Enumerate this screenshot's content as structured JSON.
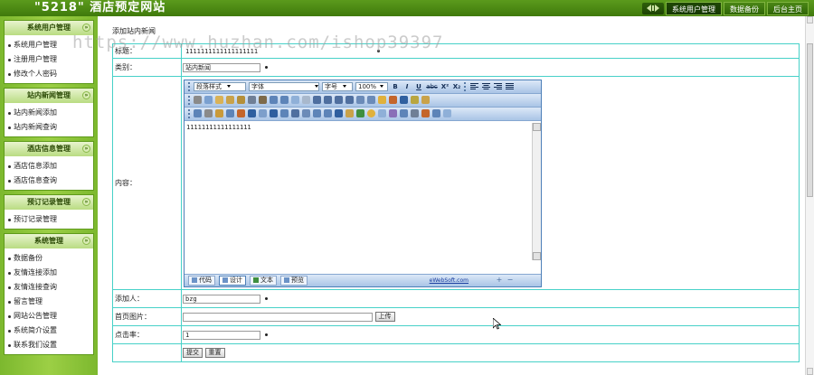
{
  "header": {
    "site_title": "\"5218\" 酒店预定网站",
    "nav": [
      {
        "label": "系统用户管理"
      },
      {
        "label": "数据备份"
      },
      {
        "label": "后台主页"
      }
    ]
  },
  "sidebar": {
    "groups": [
      {
        "title": "系统用户管理",
        "items": [
          "系统用户管理",
          "注册用户管理",
          "修改个人密码"
        ]
      },
      {
        "title": "站内新闻管理",
        "items": [
          "站内新闻添加",
          "站内新闻查询"
        ]
      },
      {
        "title": "酒店信息管理",
        "items": [
          "酒店信息添加",
          "酒店信息查询"
        ]
      },
      {
        "title": "预订记录管理",
        "items": [
          "预订记录管理"
        ]
      },
      {
        "title": "系统管理",
        "items": [
          "数据备份",
          "友情连接添加",
          "友情连接查询",
          "留言管理",
          "网站公告管理",
          "系统简介设置",
          "联系我们设置"
        ]
      }
    ]
  },
  "main": {
    "heading": "添加站内新闻",
    "form": {
      "title_label": "标题：",
      "title_value": "1111111111111111111",
      "category_label": "类别：",
      "category_value": "站内新闻",
      "content_label": "内容：",
      "editor": {
        "format_select": "段落样式",
        "font_select": "字体",
        "size_select": "字号",
        "zoom_select": "100%",
        "bold": "B",
        "italic": "I",
        "underline": "U",
        "strike": "abc",
        "superscript": "X²",
        "subscript": "X₂",
        "content": "11111111111111111",
        "modes": [
          "代码",
          "设计",
          "文本",
          "预览"
        ],
        "brand": "eWebSoft.com"
      },
      "author_label": "添加人：",
      "author_value": "bzg",
      "image_label": "首页图片：",
      "upload_button": "上传",
      "clicks_label": "点击率：",
      "clicks_value": "1",
      "submit_button": "提交",
      "reset_button": "重置"
    }
  },
  "watermark": "https://www.huzhan.com/ishop39397",
  "colors": {
    "header_green": "#4a8616",
    "sidebar_green": "#8cc63c",
    "table_border": "#47d1c8",
    "editor_blue": "#a9c4e6"
  }
}
